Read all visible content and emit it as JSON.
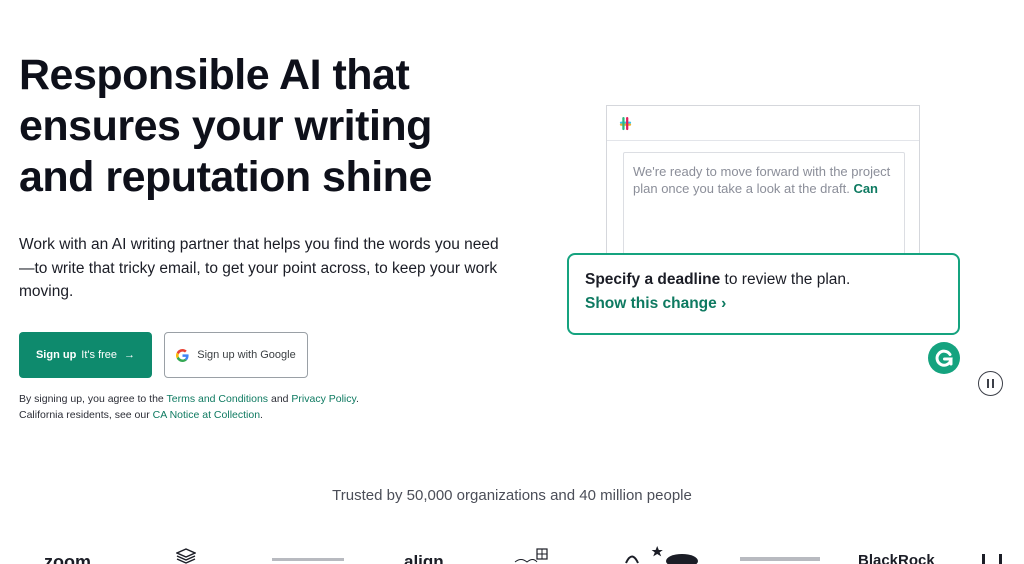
{
  "hero": {
    "title_line1": "Responsible AI that",
    "title_line2": "ensures your writing",
    "title_line3": "and reputation shine",
    "description": "Work with an AI writing partner that helps you find the words you need—to write that tricky email, to get your point across, to keep your work moving."
  },
  "cta": {
    "signup_bold": "Sign up",
    "signup_free": "It's free",
    "signup_arrow": "→",
    "google_label": "Sign up with Google"
  },
  "legal": {
    "prefix": "By signing up, you agree to the ",
    "terms": "Terms and Conditions",
    "and": " and ",
    "privacy": "Privacy Policy",
    "period1": ".",
    "line2_prefix": "California residents, see our ",
    "ca_notice": "CA Notice at Collection",
    "period2": "."
  },
  "demo": {
    "message": "We're ready to move forward with the project plan once you take a look at the draft.",
    "highlight": "Can",
    "suggestion_bold": "Specify a deadline",
    "suggestion_rest": " to review the plan.",
    "show_change": "Show this change ›"
  },
  "trusted": {
    "text": "Trusted by 50,000 organizations and 40 million people"
  },
  "logos": [
    "zoom",
    "align",
    "BlackRock"
  ],
  "colors": {
    "brand_green": "#0e8a6d",
    "accent_green": "#15a37f",
    "link_green": "#0e7a61"
  }
}
